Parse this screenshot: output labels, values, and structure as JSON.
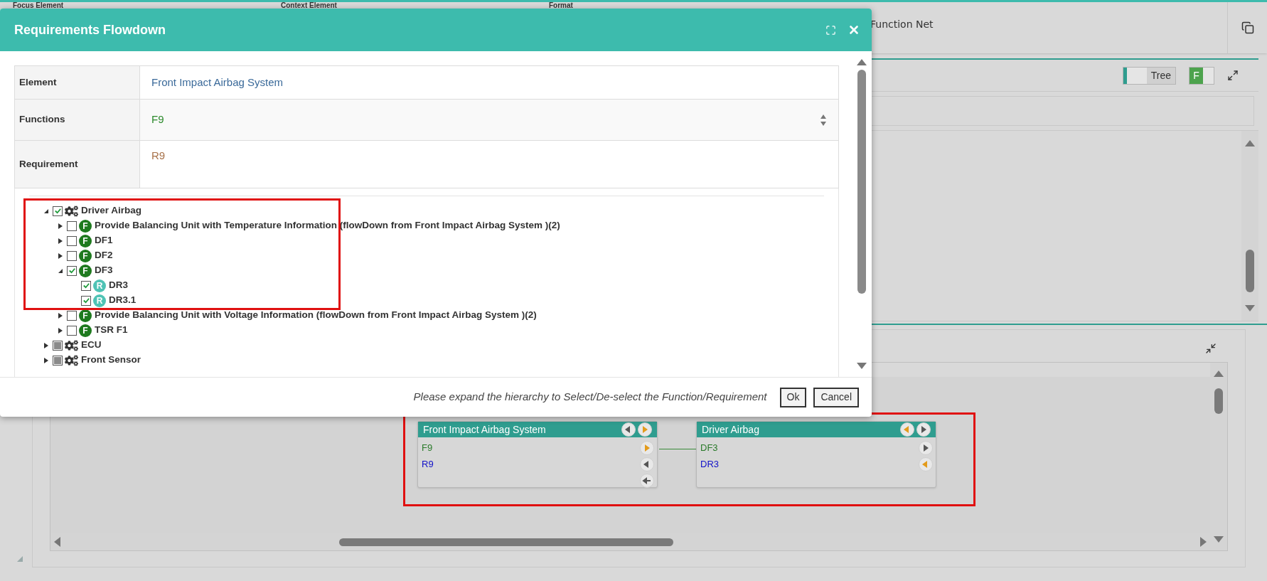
{
  "background": {
    "column_labels": [
      "Focus Element",
      "Context Element",
      "Format"
    ],
    "view_title": "Function Net",
    "view_toggle": {
      "label": "Tree",
      "on": false
    },
    "filter_toggle": {
      "label": "F",
      "on": true
    }
  },
  "dialog": {
    "title": "Requirements Flowdown",
    "fields": [
      {
        "label": "Element",
        "value": "Front Impact Airbag System",
        "kind": "text"
      },
      {
        "label": "Functions",
        "value": "F9",
        "kind": "select"
      },
      {
        "label": "Requirement",
        "value": "R9",
        "kind": "textarea"
      }
    ],
    "tree": [
      {
        "label": "Driver Airbag",
        "kind": "component",
        "checked": true,
        "partial": false,
        "expanded": true,
        "children": [
          {
            "label": "Provide Balancing Unit with Temperature Information (flowDown from Front Impact Airbag System )(2)",
            "kind": "function",
            "badge": "F",
            "checked": false,
            "partial": false,
            "expanded": false
          },
          {
            "label": "DF1",
            "kind": "function",
            "badge": "F",
            "checked": false,
            "partial": false,
            "expanded": false
          },
          {
            "label": "DF2",
            "kind": "function",
            "badge": "F",
            "checked": false,
            "partial": false,
            "expanded": false
          },
          {
            "label": "DF3",
            "kind": "function",
            "badge": "F",
            "checked": true,
            "partial": false,
            "expanded": true,
            "children": [
              {
                "label": "DR3",
                "kind": "requirement",
                "badge": "R",
                "checked": true,
                "partial": false
              },
              {
                "label": "DR3.1",
                "kind": "requirement",
                "badge": "R",
                "checked": true,
                "partial": false
              }
            ]
          },
          {
            "label": "Provide Balancing Unit with Voltage Information (flowDown from Front Impact Airbag System )(2)",
            "kind": "function",
            "badge": "F",
            "checked": false,
            "partial": false,
            "expanded": false
          },
          {
            "label": "TSR F1",
            "kind": "function",
            "badge": "F",
            "checked": false,
            "partial": false,
            "expanded": false
          }
        ]
      },
      {
        "label": "ECU",
        "kind": "component",
        "checked": false,
        "partial": true,
        "expanded": false
      },
      {
        "label": "Front Sensor",
        "kind": "component",
        "checked": false,
        "partial": true,
        "expanded": false
      }
    ],
    "hint": "Please expand the hierarchy to Select/De-select the Function/Requirement",
    "buttons": [
      "Ok",
      "Cancel"
    ]
  },
  "nodes": [
    {
      "title": "Front Impact Airbag System",
      "header_ports": [
        {
          "kind": "left",
          "active": false
        },
        {
          "kind": "right",
          "active": true
        }
      ],
      "rows": [
        {
          "label": "F9",
          "kind": "function",
          "port": {
            "kind": "right",
            "active": true
          }
        },
        {
          "label": "R9",
          "kind": "requirement",
          "port": {
            "kind": "left",
            "active": false
          }
        },
        {
          "kind": "empty",
          "port": {
            "kind": "back",
            "active": false
          }
        }
      ]
    },
    {
      "title": "Driver Airbag",
      "header_ports": [
        {
          "kind": "left",
          "active": true
        },
        {
          "kind": "right",
          "active": false
        }
      ],
      "rows": [
        {
          "label": "DF3",
          "kind": "function",
          "port": {
            "kind": "right",
            "active": false
          }
        },
        {
          "label": "DR3",
          "kind": "requirement",
          "port": {
            "kind": "left",
            "active": true
          }
        }
      ]
    }
  ]
}
